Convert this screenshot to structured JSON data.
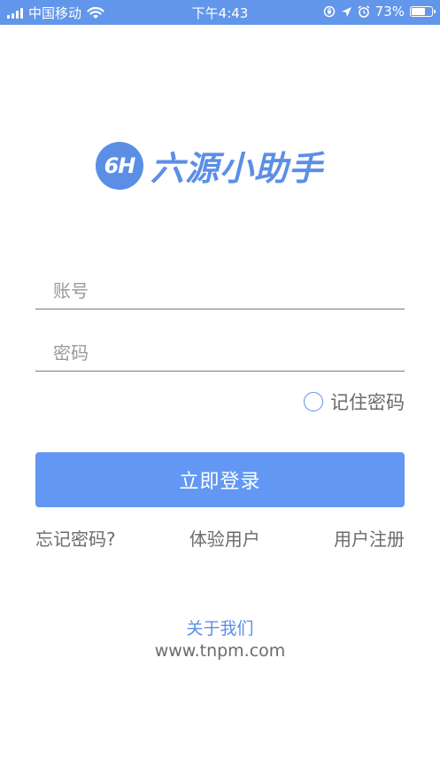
{
  "status_bar": {
    "carrier": "中国移动",
    "time": "下午4:43",
    "battery_percent": "73%",
    "battery_level": 0.73,
    "icons": [
      "signal-icon",
      "wifi-icon",
      "orientation-lock-icon",
      "location-icon",
      "alarm-icon",
      "battery-icon"
    ],
    "background": "#6296ea"
  },
  "logo": {
    "badge_text": "6H",
    "title": "六源小助手",
    "color": "#5b8fe6"
  },
  "form": {
    "account_placeholder": "账号",
    "account_value": "",
    "password_placeholder": "密码",
    "password_value": "",
    "remember_label": "记住密码",
    "remember_checked": false,
    "login_button": "立即登录",
    "accent": "#6298f3"
  },
  "links": {
    "forgot": "忘记密码?",
    "trial": "体验用户",
    "register": "用户注册"
  },
  "footer": {
    "about": "关于我们",
    "site": "www.tnpm.com"
  }
}
